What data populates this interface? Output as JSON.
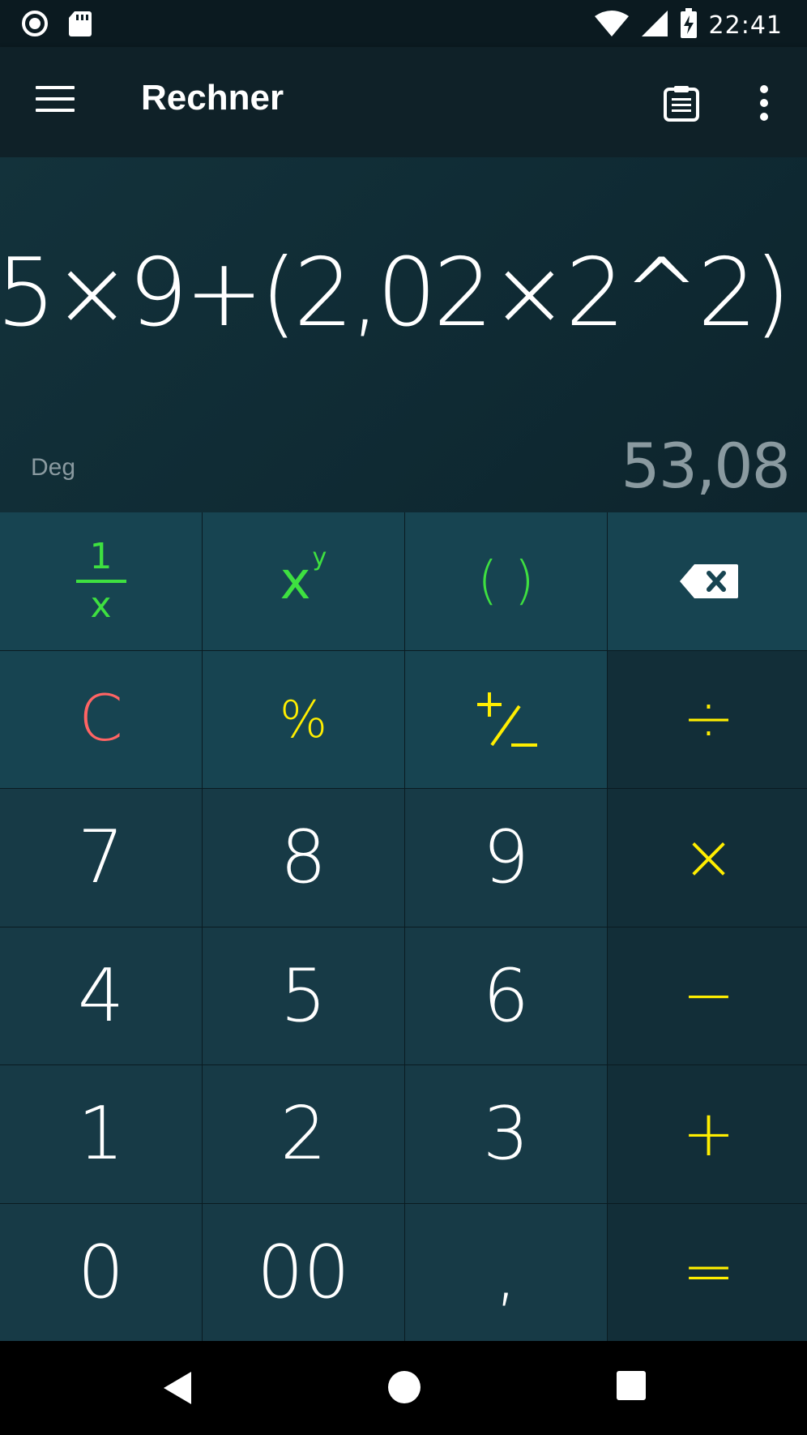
{
  "status": {
    "time": "22:41",
    "icons": [
      "circle-indicator-icon",
      "sd-card-icon",
      "wifi-icon",
      "signal-icon",
      "battery-charging-icon"
    ]
  },
  "app_bar": {
    "title": "Rechner",
    "icons": [
      "menu-icon",
      "clipboard-icon",
      "more-vert-icon"
    ]
  },
  "display": {
    "expression": "5×9+(2,02×2^2)",
    "mode": "Deg",
    "result": "53,08"
  },
  "keypad": {
    "rows": [
      [
        "1/x",
        "x^y",
        "( )",
        "⌫"
      ],
      [
        "C",
        "%",
        "+/−",
        "÷"
      ],
      [
        "7",
        "8",
        "9",
        "×"
      ],
      [
        "4",
        "5",
        "6",
        "−"
      ],
      [
        "1",
        "2",
        "3",
        "+"
      ],
      [
        "0",
        "00",
        ",",
        "="
      ]
    ],
    "fraction_top": "1",
    "fraction_bottom": "x",
    "power_base": "x",
    "power_exp": "y",
    "parens": "( )",
    "clear": "C",
    "percent": "%",
    "divide": "÷",
    "multiply": "×",
    "minus": "−",
    "plus": "+",
    "equals": "=",
    "digits": {
      "seven": "7",
      "eight": "8",
      "nine": "9",
      "four": "4",
      "five": "5",
      "six": "6",
      "one": "1",
      "two": "2",
      "three": "3",
      "zero": "0",
      "double_zero": "00",
      "comma": ","
    }
  },
  "colors": {
    "function_green": "#3ee040",
    "operator_yellow": "#ffee00",
    "clear_red": "#ff6464",
    "display_bg": "#13323b",
    "result_gray": "#8a9aa0"
  }
}
